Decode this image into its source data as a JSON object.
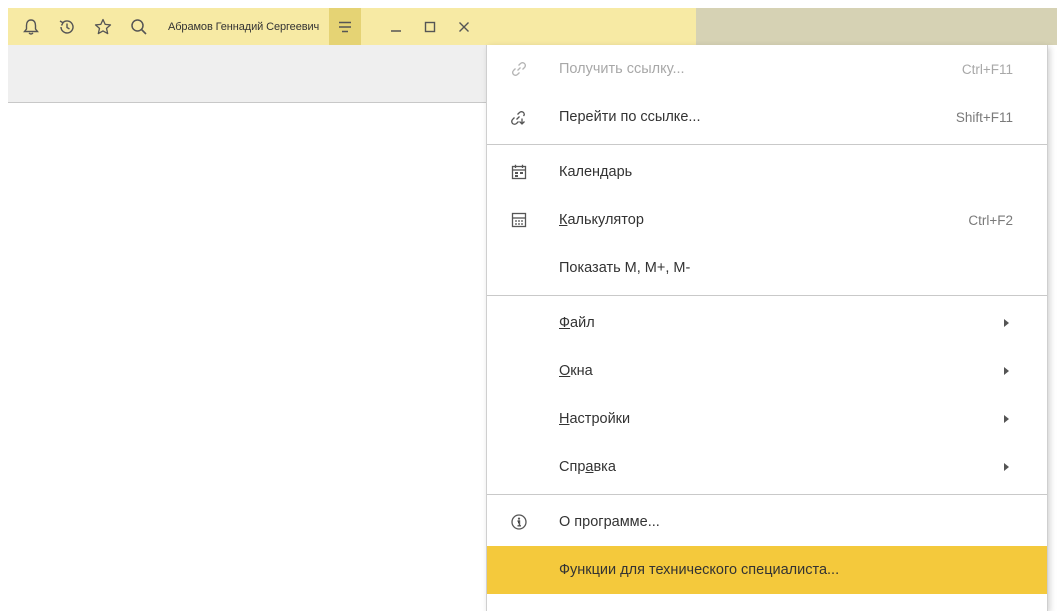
{
  "topbar": {
    "user_name": "Абрамов Геннадий Сергеевич",
    "icons": [
      "bell-icon",
      "history-icon",
      "star-icon",
      "search-icon"
    ],
    "menu_icon": "hamburger-menu-icon",
    "window_controls": [
      "minimize-icon",
      "maximize-icon",
      "close-icon"
    ],
    "bar_color": "#f7eaa4",
    "active_color": "#e5d374"
  },
  "menu": {
    "highlight_color": "#f4c93c",
    "get_link": {
      "label": "Получить ссылку...",
      "shortcut": "Ctrl+F11",
      "icon": "link-icon",
      "disabled": true
    },
    "go_to_link": {
      "label": "Перейти по ссылке...",
      "shortcut": "Shift+F11",
      "icon": "link-go-icon"
    },
    "calendar": {
      "label": "Календарь",
      "icon": "calendar-icon"
    },
    "calculator": {
      "label_first": "К",
      "label_rest": "алькулятор",
      "shortcut": "Ctrl+F2",
      "icon": "calculator-icon"
    },
    "show_memory": {
      "label": "Показать М, М+, М-"
    },
    "file": {
      "label_first": "Ф",
      "label_rest": "айл"
    },
    "windows": {
      "label_first": "О",
      "label_rest": "кна"
    },
    "settings": {
      "label_first": "Н",
      "label_rest": "астройки"
    },
    "help": {
      "label_pre": "Спр",
      "label_u": "а",
      "label_post": "вка"
    },
    "about": {
      "label": "О программе...",
      "icon": "info-icon"
    },
    "tech_functions": {
      "label": "Функции для технического специалиста..."
    }
  }
}
